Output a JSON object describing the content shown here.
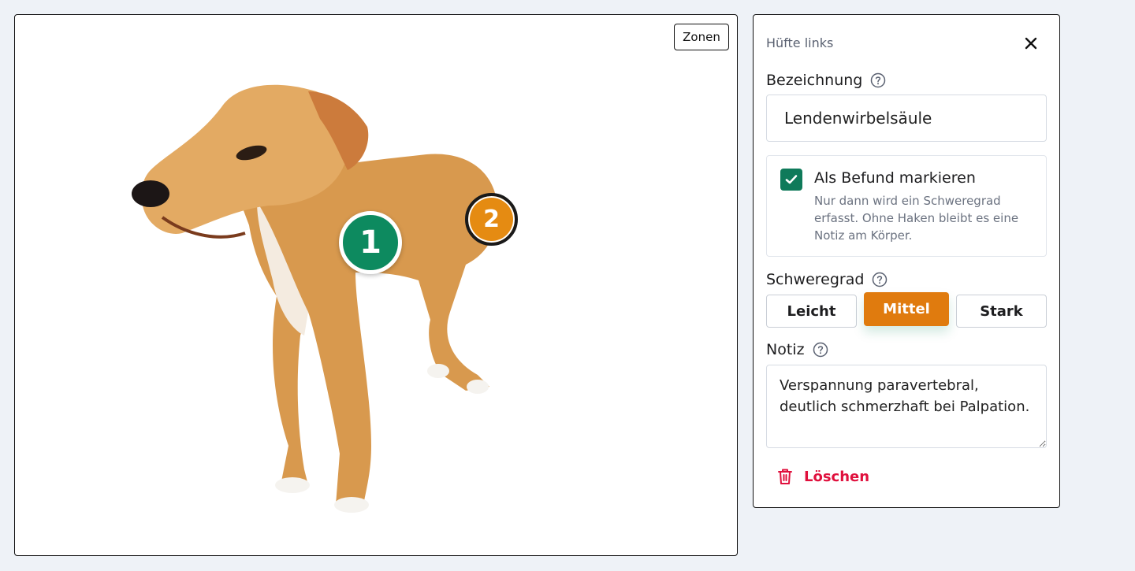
{
  "viewer": {
    "zones_button": "Zonen",
    "markers": [
      {
        "number": "1",
        "color": "#0d8a5f"
      },
      {
        "number": "2",
        "color": "#e58b12"
      }
    ]
  },
  "panel": {
    "title": "Hüfte links",
    "close_icon": "close-icon",
    "name_label": "Bezeichnung",
    "name_value": "Lendenwirbelsäule",
    "finding": {
      "checked": true,
      "label": "Als Befund markieren",
      "description": "Nur dann wird ein Schweregrad erfasst. Ohne Haken bleibt es eine Notiz am Körper."
    },
    "severity_label": "Schweregrad",
    "severity_options": [
      "Leicht",
      "Mittel",
      "Stark"
    ],
    "severity_selected": "Mittel",
    "note_label": "Notiz",
    "note_value": "Verspannung paravertebral, deutlich schmerzhaft bei Palpation.",
    "delete_label": "Löschen"
  },
  "colors": {
    "accent_green": "#0f7a5a",
    "accent_orange": "#e07b0e",
    "danger": "#e0103d"
  }
}
